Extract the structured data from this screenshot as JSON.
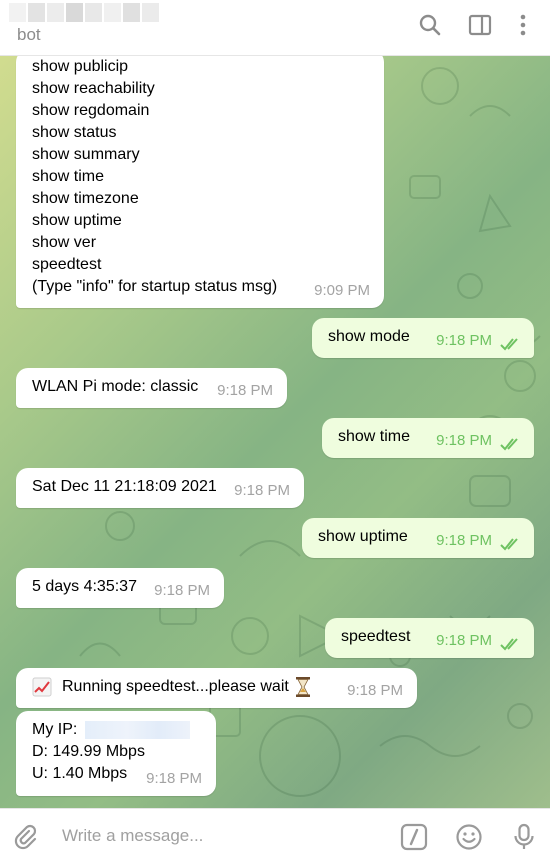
{
  "header": {
    "subtitle": "bot",
    "icons": [
      "search-icon",
      "sidebar-toggle-icon",
      "more-vertical-icon"
    ]
  },
  "messages": {
    "help_list": {
      "lines": [
        "show publicip",
        "show reachability",
        "show regdomain",
        "show status",
        "show summary",
        "show time",
        "show timezone",
        "show uptime",
        "show ver",
        "speedtest",
        "(Type \"info\" for startup status msg)"
      ],
      "time": "9:09 PM"
    },
    "out_mode": {
      "text": "show mode",
      "time": "9:18 PM"
    },
    "in_mode": {
      "text": "WLAN Pi mode: classic",
      "time": "9:18 PM"
    },
    "out_time": {
      "text": "show time",
      "time": "9:18 PM"
    },
    "in_time": {
      "text": "Sat Dec 11 21:18:09 2021",
      "time": "9:18 PM"
    },
    "out_uptime": {
      "text": "show uptime",
      "time": "9:18 PM"
    },
    "in_uptime": {
      "text": "5 days 4:35:37",
      "time": "9:18 PM"
    },
    "out_speedtest": {
      "text": "speedtest",
      "time": "9:18 PM"
    },
    "in_running": {
      "text": "Running speedtest...please wait",
      "time": "9:18 PM",
      "icons": [
        "chart-increasing-icon",
        "hourglass-icon"
      ]
    },
    "in_result": {
      "ip_label": "My IP:",
      "download": "D: 149.99 Mbps",
      "upload": "U: 1.40 Mbps",
      "time": "9:18 PM"
    }
  },
  "input": {
    "placeholder": "Write a message...",
    "icons": [
      "attach-icon",
      "bot-command-icon",
      "emoji-icon",
      "microphone-icon"
    ]
  },
  "colors": {
    "outgoing_bubble": "#effdde",
    "incoming_bubble": "#ffffff",
    "read_ticks": "#6ec261",
    "header_icons": "#8c8c8c"
  }
}
